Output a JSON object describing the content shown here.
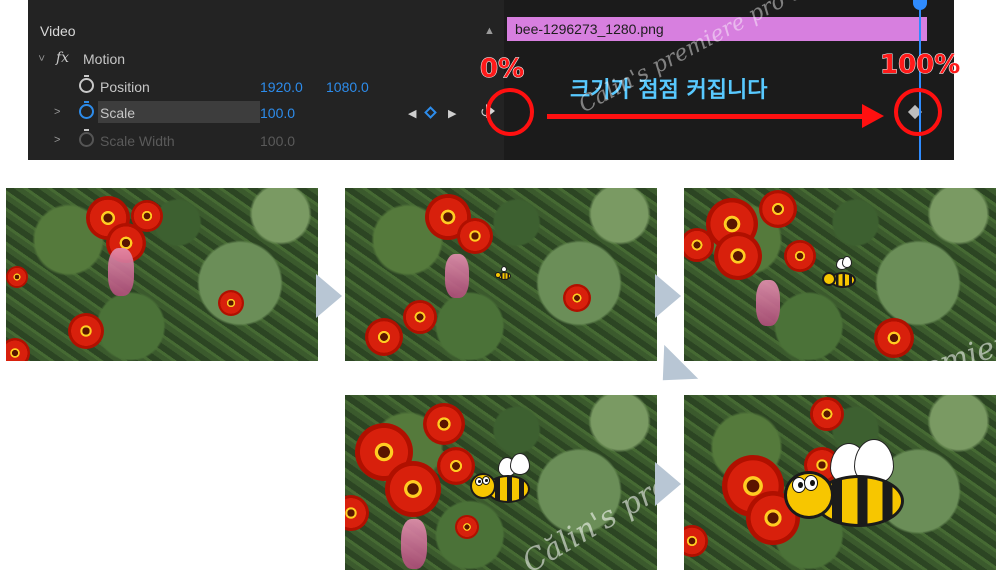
{
  "panel": {
    "section_title": "Video",
    "motion_label": "Motion",
    "fx_symbol": "fx",
    "properties": [
      {
        "label": "Position",
        "value_x": "1920.0",
        "value_y": "1080.0"
      },
      {
        "label": "Scale",
        "value": "100.0"
      },
      {
        "label": "Scale Width",
        "value": "100.0"
      }
    ],
    "clip_name": "bee-1296273_1280.png",
    "scroll_up_glyph": "▲",
    "reset_glyph": "↺",
    "nav_prev": "◀",
    "nav_next": "▶",
    "keyframe_glyph": "◆"
  },
  "annotation": {
    "start_label": "0%",
    "end_label": "100%",
    "caption": "크기가 점점 커집니다",
    "watermark": "Călin's premiere pro tutorials",
    "accent_red": "#ff1010",
    "caption_color": "#58c9ff"
  },
  "frames": {
    "count": 5,
    "arrow_color": "#b8c6d4",
    "watermark": "Călin's premiere pro tutorials"
  }
}
